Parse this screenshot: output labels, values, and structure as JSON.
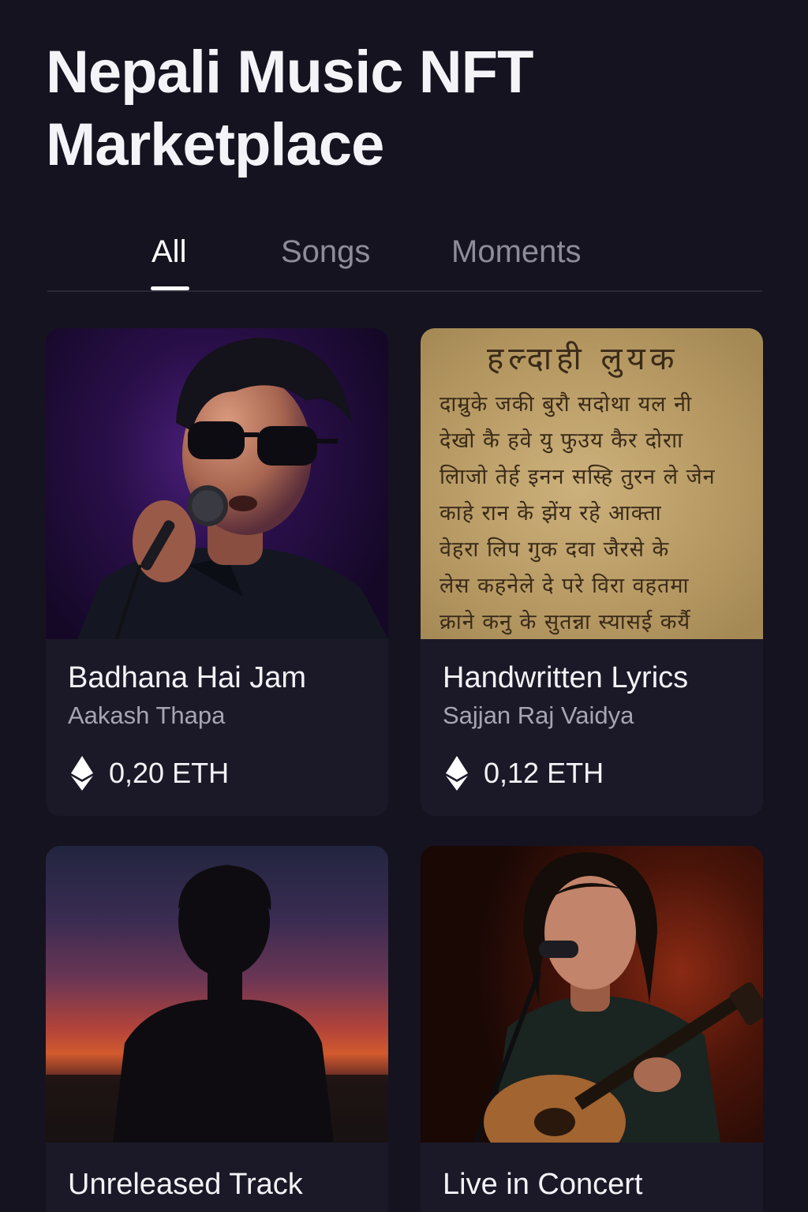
{
  "page": {
    "title_line1": "Nepali Music NFT",
    "title_line2": "Marketplace"
  },
  "tabs": [
    {
      "label": "All",
      "active": true
    },
    {
      "label": "Songs",
      "active": false
    },
    {
      "label": "Moments",
      "active": false
    }
  ],
  "cards": [
    {
      "title": "Badhana Hai Jam",
      "artist": "Aakash Thapa",
      "price": "0,20 ETH",
      "image": "singer-with-sunglasses-photo"
    },
    {
      "title": "Handwritten Lyrics",
      "artist": "Sajjan Raj Vaidya",
      "price": "0,12 ETH",
      "image": "handwritten-lyrics-paper-photo",
      "lyrics_heading": "हल्दाही लुयक",
      "lyrics_lines": [
        "दाम्रुके जकी बुरौ सदोथा यल नी",
        "देखो कै हवे यु फुउय कैर दोराा",
        "लिाजो तेर्ह इनन सस्हि तुरन ले जेन",
        "काहे रान के झेंय रहे आक्ता",
        "वेहरा लिप गुक दवा जैरसे के",
        "लेस कहनेले दे परे विरा वहतमा",
        "क्राने कनु के सुतन्ना स्यासई कर्यै"
      ]
    },
    {
      "title": "Unreleased Track",
      "image": "silhouette-sunset-photo"
    },
    {
      "title": "Live in Concert",
      "image": "guitarist-singing-photo"
    }
  ],
  "colors": {
    "background": "#15131f",
    "card": "#1b1928",
    "tab_inactive": "#8e8c9a",
    "accent_text": "#ffffff"
  }
}
